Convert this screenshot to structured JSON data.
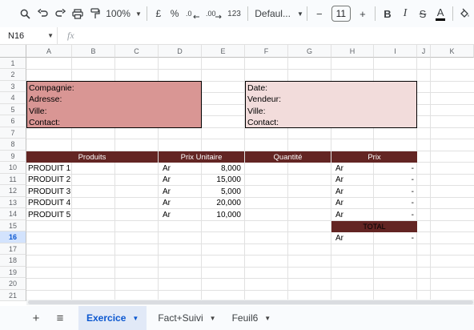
{
  "toolbar": {
    "zoom": "100%",
    "currency": "£",
    "percent": "%",
    "dec_decrease": ".0←",
    "dec_increase": ".00→",
    "number_format": "123",
    "font": "Defaul...",
    "font_size": "11",
    "minus": "−",
    "plus": "+",
    "bold": "B",
    "italic": "I",
    "strike": "S",
    "text_color": "A",
    "accent_color": "#0b57d0"
  },
  "formula_bar": {
    "cell_ref": "N16",
    "fx": "fx",
    "value": ""
  },
  "columns": [
    "A",
    "B",
    "C",
    "D",
    "E",
    "F",
    "G",
    "H",
    "I",
    "J",
    "K"
  ],
  "rows": [
    "1",
    "2",
    "3",
    "4",
    "5",
    "6",
    "7",
    "8",
    "9",
    "10",
    "11",
    "12",
    "13",
    "14",
    "15",
    "16",
    "17",
    "18",
    "19",
    "20",
    "21"
  ],
  "selected_row": "16",
  "company_box": {
    "lines": [
      "Compagnie:",
      "Adresse:",
      "Ville:",
      "Contact:"
    ],
    "color": "#d99694"
  },
  "info_box": {
    "lines": [
      "Date:",
      "Vendeur:",
      "Ville:",
      "Contact:"
    ],
    "color": "#f2dcdb"
  },
  "table": {
    "headers": [
      "Produits",
      "Prix Unitaire",
      "Quantité",
      "Prix"
    ],
    "header_color": "#632523",
    "rows": [
      {
        "product": "PRODUIT 1",
        "currency": "Ar",
        "unit_price": "8,000",
        "price_currency": "Ar",
        "price": "-"
      },
      {
        "product": "PRODUIT 2",
        "currency": "Ar",
        "unit_price": "15,000",
        "price_currency": "Ar",
        "price": "-"
      },
      {
        "product": "PRODUIT 3",
        "currency": "Ar",
        "unit_price": "5,000",
        "price_currency": "Ar",
        "price": "-"
      },
      {
        "product": "PRODUIT 4",
        "currency": "Ar",
        "unit_price": "20,000",
        "price_currency": "Ar",
        "price": "-"
      },
      {
        "product": "PRODUIT 5",
        "currency": "Ar",
        "unit_price": "10,000",
        "price_currency": "Ar",
        "price": "-"
      }
    ],
    "total_label": "TOTAL",
    "total_currency": "Ar",
    "total_value": "-"
  },
  "sheets": [
    {
      "name": "Exercice",
      "active": true
    },
    {
      "name": "Fact+Suivi",
      "active": false
    },
    {
      "name": "Feuil6",
      "active": false
    }
  ],
  "sheetbar": {
    "add": "+",
    "menu": "≡"
  }
}
